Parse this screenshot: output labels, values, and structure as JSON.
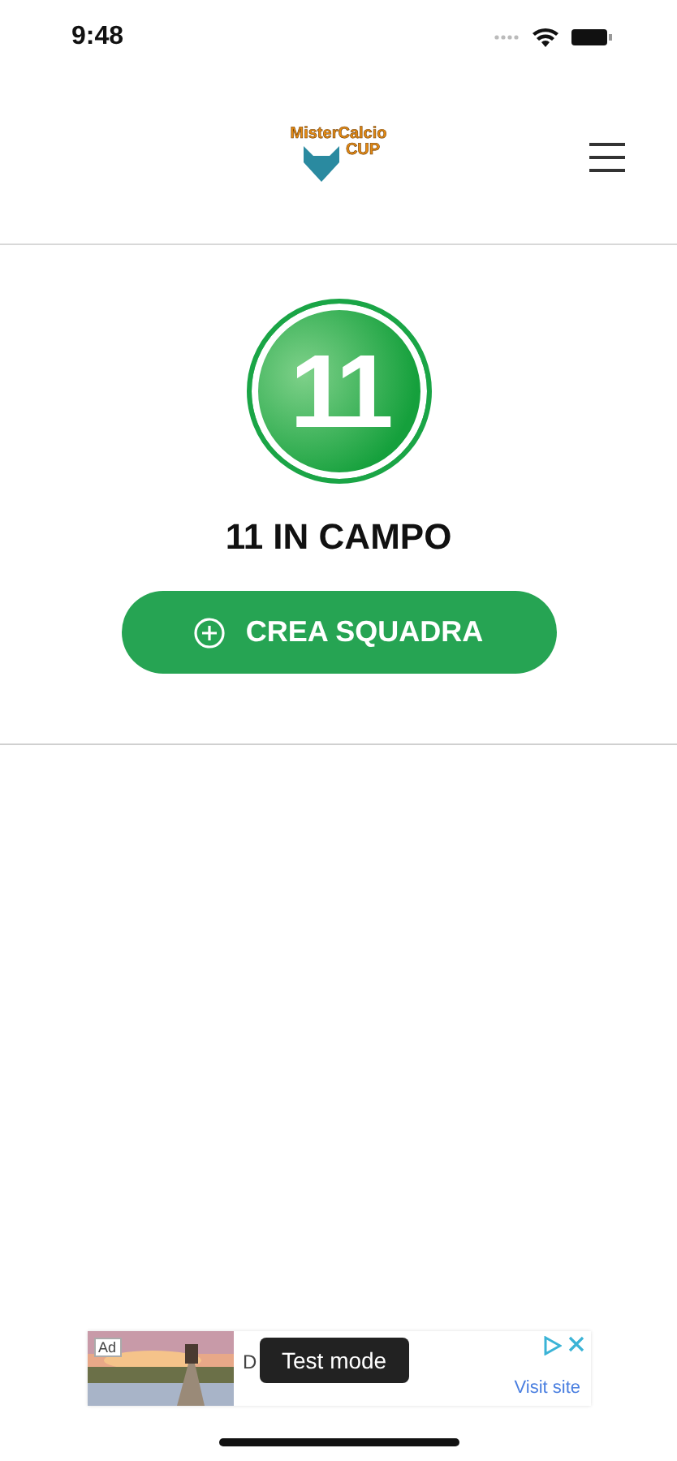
{
  "status_bar": {
    "time": "9:48"
  },
  "header": {
    "logo": {
      "line_1": "MisterCalcio",
      "line_2": "CUP"
    }
  },
  "mode": {
    "badge": "11",
    "title": "11 IN CAMPO",
    "button": "CREA SQUADRA"
  },
  "ad": {
    "kind": "picture",
    "badge": "Ad",
    "headline": "D",
    "tooltip": "Test mode",
    "action": "Visit site"
  }
}
